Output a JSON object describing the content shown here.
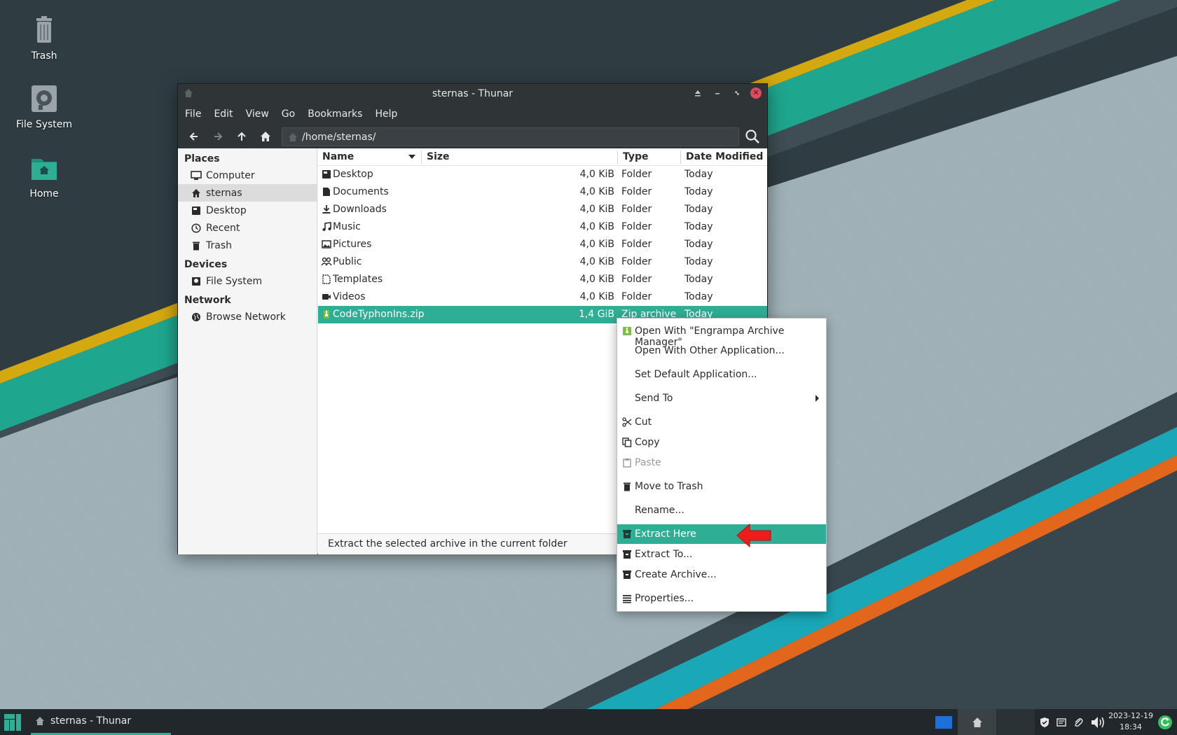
{
  "desktop": {
    "icons": [
      {
        "label": "Trash",
        "icon": "trash-icon"
      },
      {
        "label": "File System",
        "icon": "drive-icon"
      },
      {
        "label": "Home",
        "icon": "home-folder-icon"
      }
    ]
  },
  "window": {
    "title": "sternas - Thunar",
    "menu": [
      "File",
      "Edit",
      "View",
      "Go",
      "Bookmarks",
      "Help"
    ],
    "location": "/home/sternas/"
  },
  "sidebar": {
    "places_heading": "Places",
    "places": [
      {
        "label": "Computer",
        "icon": "computer-icon"
      },
      {
        "label": "sternas",
        "icon": "home-icon",
        "active": true
      },
      {
        "label": "Desktop",
        "icon": "desktop-icon"
      },
      {
        "label": "Recent",
        "icon": "clock-icon"
      },
      {
        "label": "Trash",
        "icon": "trash-icon"
      }
    ],
    "devices_heading": "Devices",
    "devices": [
      {
        "label": "File System",
        "icon": "drive-icon"
      }
    ],
    "network_heading": "Network",
    "network": [
      {
        "label": "Browse Network",
        "icon": "network-icon"
      }
    ]
  },
  "filelist": {
    "columns": {
      "name": "Name",
      "size": "Size",
      "type": "Type",
      "date": "Date Modified"
    },
    "rows": [
      {
        "name": "Desktop",
        "size": "4,0 KiB",
        "type": "Folder",
        "date": "Today",
        "icon": "desktop-folder-icon"
      },
      {
        "name": "Documents",
        "size": "4,0 KiB",
        "type": "Folder",
        "date": "Today",
        "icon": "documents-folder-icon"
      },
      {
        "name": "Downloads",
        "size": "4,0 KiB",
        "type": "Folder",
        "date": "Today",
        "icon": "downloads-folder-icon"
      },
      {
        "name": "Music",
        "size": "4,0 KiB",
        "type": "Folder",
        "date": "Today",
        "icon": "music-folder-icon"
      },
      {
        "name": "Pictures",
        "size": "4,0 KiB",
        "type": "Folder",
        "date": "Today",
        "icon": "pictures-folder-icon"
      },
      {
        "name": "Public",
        "size": "4,0 KiB",
        "type": "Folder",
        "date": "Today",
        "icon": "public-folder-icon"
      },
      {
        "name": "Templates",
        "size": "4,0 KiB",
        "type": "Folder",
        "date": "Today",
        "icon": "templates-folder-icon"
      },
      {
        "name": "Videos",
        "size": "4,0 KiB",
        "type": "Folder",
        "date": "Today",
        "icon": "videos-folder-icon"
      },
      {
        "name": "CodeTyphonIns.zip",
        "size": "1,4 GiB",
        "type": "Zip archive",
        "date": "Today",
        "icon": "zip-archive-icon",
        "selected": true
      }
    ],
    "status": "Extract the selected archive in the current folder"
  },
  "context_menu": {
    "items": [
      {
        "label": "Open With \"Engrampa Archive Manager\"",
        "icon": "engrampa-icon"
      },
      {
        "label": "Open With Other Application..."
      },
      {
        "label": "Set Default Application..."
      },
      {
        "label": "Send To",
        "submenu": true
      },
      {
        "label": "Cut",
        "icon": "scissors-icon"
      },
      {
        "label": "Copy",
        "icon": "copy-icon"
      },
      {
        "label": "Paste",
        "icon": "paste-icon",
        "disabled": true
      },
      {
        "label": "Move to Trash",
        "icon": "trash-icon"
      },
      {
        "label": "Rename..."
      },
      {
        "label": "Extract Here",
        "icon": "archive-icon",
        "highlighted": true
      },
      {
        "label": "Extract To...",
        "icon": "archive-icon"
      },
      {
        "label": "Create Archive...",
        "icon": "archive-icon"
      },
      {
        "label": "Properties...",
        "icon": "properties-icon"
      }
    ]
  },
  "taskbar": {
    "task_label": "sternas - Thunar",
    "date": "2023-12-19",
    "time": "18:34"
  },
  "colors": {
    "accent": "#2eae94",
    "titlebar": "#2f3437",
    "close": "#e04a5a",
    "pointer_arrow": "#ee1c1c"
  }
}
